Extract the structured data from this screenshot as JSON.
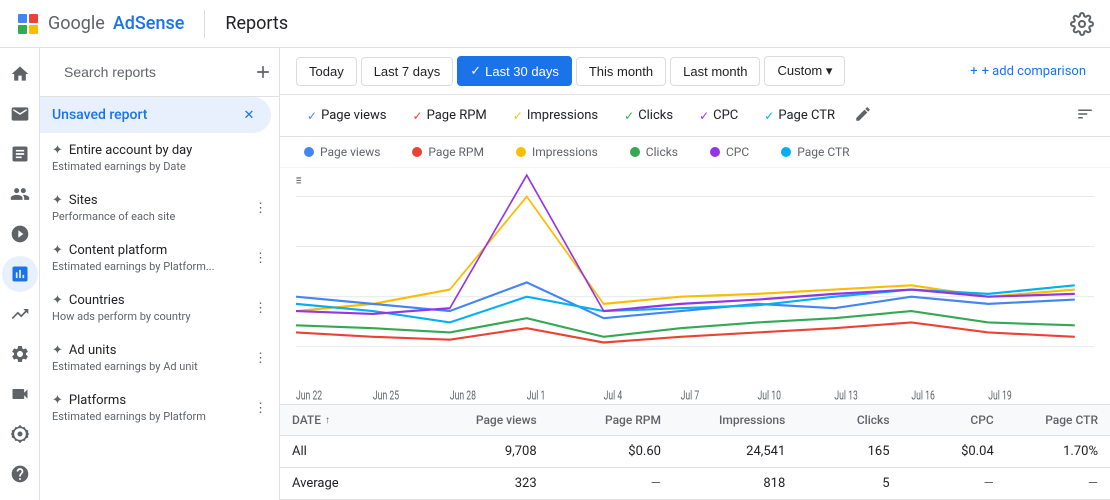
{
  "app": {
    "logo_icon": "G",
    "logo_text": "Google",
    "logo_brand": "AdSense",
    "title": "Reports"
  },
  "filters": {
    "buttons": [
      {
        "id": "today",
        "label": "Today",
        "active": false
      },
      {
        "id": "last7",
        "label": "Last 7 days",
        "active": false
      },
      {
        "id": "last30",
        "label": "Last 30 days",
        "active": true,
        "checked": true
      },
      {
        "id": "thismonth",
        "label": "This month",
        "active": false
      },
      {
        "id": "lastmonth",
        "label": "Last month",
        "active": false
      },
      {
        "id": "custom",
        "label": "Custom",
        "active": false,
        "dropdown": true
      }
    ],
    "add_comparison": "+ add comparison"
  },
  "sidebar": {
    "search_placeholder": "Search reports",
    "add_label": "+",
    "active_report": "Unsaved report",
    "items": [
      {
        "id": "entire-account",
        "name": "Entire account by day",
        "desc": "Estimated earnings by Date",
        "sparkle": true
      },
      {
        "id": "sites",
        "name": "Sites",
        "desc": "Performance of each site",
        "sparkle": true
      },
      {
        "id": "content-platform",
        "name": "Content platform",
        "desc": "Estimated earnings by Platform...",
        "sparkle": true
      },
      {
        "id": "countries",
        "name": "Countries",
        "desc": "How ads perform by country",
        "sparkle": true
      },
      {
        "id": "ad-units",
        "name": "Ad units",
        "desc": "Estimated earnings by Ad unit",
        "sparkle": true
      },
      {
        "id": "platforms",
        "name": "Platforms",
        "desc": "Estimated earnings by Platform",
        "sparkle": true
      }
    ]
  },
  "metrics": {
    "tabs": [
      {
        "id": "page-views",
        "label": "Page views",
        "checked": true
      },
      {
        "id": "page-rpm",
        "label": "Page RPM",
        "checked": true
      },
      {
        "id": "impressions",
        "label": "Impressions",
        "checked": true
      },
      {
        "id": "clicks",
        "label": "Clicks",
        "checked": true
      },
      {
        "id": "cpc",
        "label": "CPC",
        "checked": true
      },
      {
        "id": "page-ctr",
        "label": "Page CTR",
        "checked": true
      }
    ]
  },
  "legend": {
    "items": [
      {
        "label": "Page views",
        "color": "#4285f4"
      },
      {
        "label": "Page RPM",
        "color": "#ea4335"
      },
      {
        "label": "Impressions",
        "color": "#fbbc04"
      },
      {
        "label": "Clicks",
        "color": "#34a853"
      },
      {
        "label": "CPC",
        "color": "#9334e6"
      },
      {
        "label": "Page CTR",
        "color": "#00b0f0"
      }
    ]
  },
  "chart": {
    "x_labels": [
      "Jun 22",
      "Jun 25",
      "Jun 28",
      "Jul 1",
      "Jul 4",
      "Jul 7",
      "Jul 10",
      "Jul 13",
      "Jul 16",
      "Jul 19"
    ],
    "colors": {
      "page_views": "#4285f4",
      "page_rpm": "#ea4335",
      "impressions": "#fbbc04",
      "clicks": "#34a853",
      "cpc": "#9334e6",
      "page_ctr": "#00b0f0"
    }
  },
  "table": {
    "headers": [
      {
        "id": "date",
        "label": "DATE",
        "sortable": true
      },
      {
        "id": "pageviews",
        "label": "Page views"
      },
      {
        "id": "pagerpm",
        "label": "Page RPM"
      },
      {
        "id": "impressions",
        "label": "Impressions"
      },
      {
        "id": "clicks",
        "label": "Clicks"
      },
      {
        "id": "cpc",
        "label": "CPC"
      },
      {
        "id": "pagectr",
        "label": "Page CTR"
      }
    ],
    "rows": [
      {
        "date": "All",
        "pageviews": "9,708",
        "pagerpm": "$0.60",
        "impressions": "24,541",
        "clicks": "165",
        "cpc": "$0.04",
        "pagectr": "1.70%"
      },
      {
        "date": "Average",
        "pageviews": "323",
        "pagerpm": "—",
        "impressions": "818",
        "clicks": "5",
        "cpc": "—",
        "pagectr": "—"
      }
    ]
  },
  "nav_icons": [
    {
      "id": "home",
      "label": "Home"
    },
    {
      "id": "inbox",
      "label": "Inbox"
    },
    {
      "id": "reports",
      "label": "Reports"
    },
    {
      "id": "content",
      "label": "Content"
    },
    {
      "id": "people",
      "label": "People"
    },
    {
      "id": "block",
      "label": "Block"
    },
    {
      "id": "chart",
      "label": "Chart",
      "active": true
    },
    {
      "id": "trending",
      "label": "Trending"
    },
    {
      "id": "settings",
      "label": "Settings"
    },
    {
      "id": "video",
      "label": "Video"
    },
    {
      "id": "gear",
      "label": "Gear"
    },
    {
      "id": "help",
      "label": "Help"
    }
  ]
}
